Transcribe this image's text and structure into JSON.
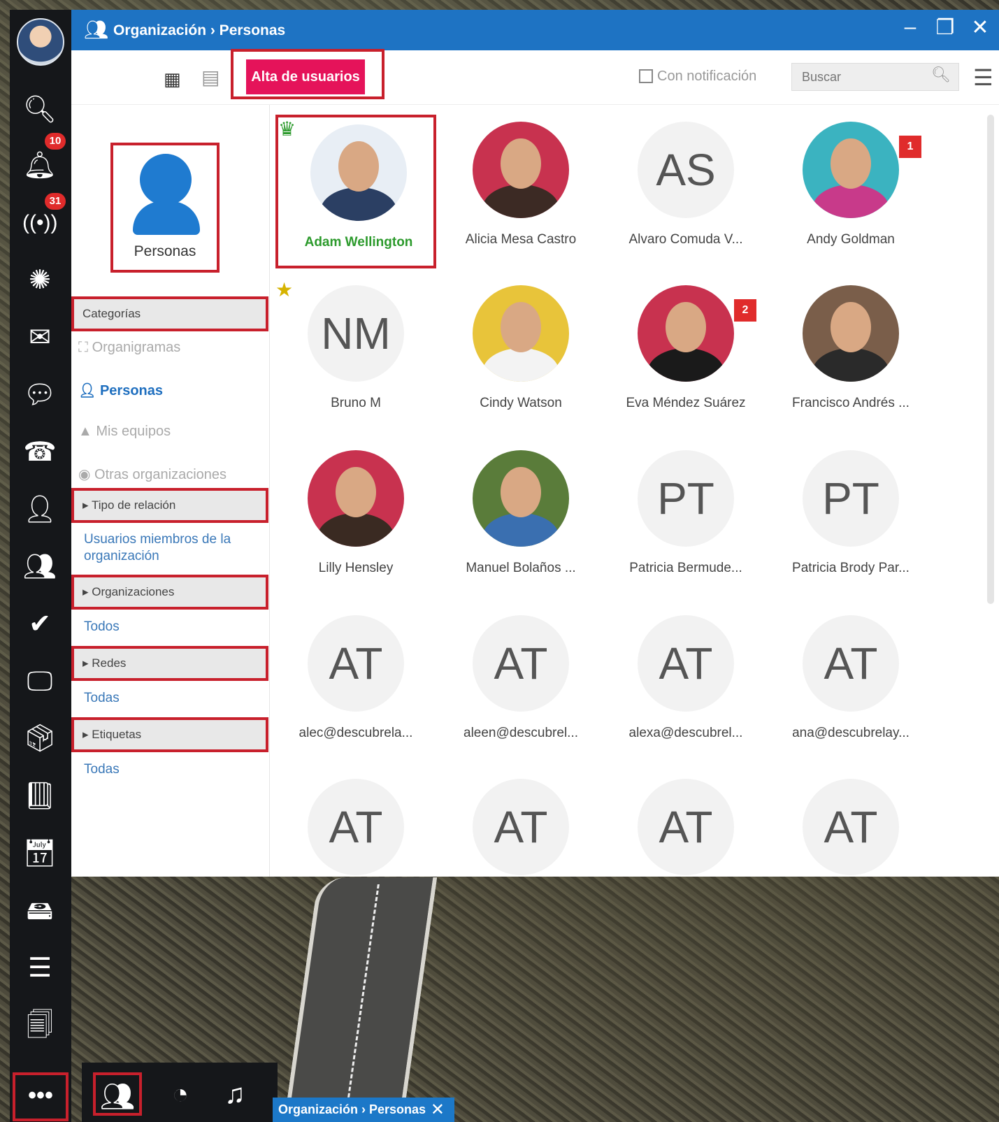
{
  "window": {
    "title": "Organización › Personas",
    "minimize": "–",
    "maximize": "❐",
    "close": "✕"
  },
  "toolbar": {
    "alta_label": "Alta de usuarios",
    "uncategorized_label": "Con notificación",
    "search_placeholder": "Buscar",
    "view_grid_icon": "grid-icon",
    "view_table_icon": "table-icon"
  },
  "sidebar": {
    "personas_label": "Personas",
    "categories_header": "Categorías",
    "items": [
      {
        "label": "Organigramas",
        "icon": "org-chart-icon"
      },
      {
        "label": "Personas",
        "icon": "person-icon"
      },
      {
        "label": "Mis equipos",
        "icon": "team-icon"
      },
      {
        "label": "Otras organizaciones",
        "icon": "globe-icon"
      }
    ],
    "relation_header": "Tipo de relación",
    "relation_value": "Usuarios miembros de la organización",
    "orgs_header": "Organizaciones",
    "orgs_value": "Todos",
    "networks_header": "Redes",
    "networks_value": "Todas",
    "tags_header": "Etiquetas",
    "tags_value": "Todas"
  },
  "people": [
    {
      "name": "Adam Wellington",
      "kind": "photo",
      "bg": "#e8eef5",
      "body": "#2b3f63",
      "crown": true,
      "highlight": true,
      "name_color": "#2c9a2c"
    },
    {
      "name": "Alicia Mesa Castro",
      "kind": "photo",
      "bg": "#c8324f",
      "body": "#3c2a24"
    },
    {
      "name": "Alvaro Comuda V...",
      "kind": "initials",
      "initials": "AS"
    },
    {
      "name": "Andy Goldman",
      "kind": "photo",
      "bg": "#3bb3c0",
      "body": "#c83a8a",
      "badge": "1"
    },
    {
      "name": "Bruno M",
      "kind": "initials",
      "initials": "NM",
      "star": true
    },
    {
      "name": "Cindy Watson",
      "kind": "photo",
      "bg": "#e8c43a",
      "body": "#f3f3f3"
    },
    {
      "name": "Eva Méndez Suárez",
      "kind": "photo",
      "bg": "#c8324f",
      "body": "#1a1a1a",
      "badge": "2"
    },
    {
      "name": "Francisco Andrés ...",
      "kind": "photo",
      "bg": "#7a5e4a",
      "body": "#2a2a2a"
    },
    {
      "name": "Lilly Hensley",
      "kind": "photo",
      "bg": "#c8324f",
      "body": "#3a2a22"
    },
    {
      "name": "Manuel Bolaños ...",
      "kind": "photo",
      "bg": "#5a7c3a",
      "body": "#3a6fb0"
    },
    {
      "name": "Patricia Bermude...",
      "kind": "initials",
      "initials": "PT"
    },
    {
      "name": "Patricia Brody Par...",
      "kind": "initials",
      "initials": "PT"
    },
    {
      "name": "alec@descubrela...",
      "kind": "initials",
      "initials": "AT"
    },
    {
      "name": "aleen@descubrel...",
      "kind": "initials",
      "initials": "AT"
    },
    {
      "name": "alexa@descubrel...",
      "kind": "initials",
      "initials": "AT"
    },
    {
      "name": "ana@descubrelay...",
      "kind": "initials",
      "initials": "AT"
    },
    {
      "name": "",
      "kind": "initials",
      "initials": "AT"
    },
    {
      "name": "",
      "kind": "initials",
      "initials": "AT"
    },
    {
      "name": "",
      "kind": "initials",
      "initials": "AT"
    },
    {
      "name": "",
      "kind": "initials",
      "initials": "AT"
    }
  ],
  "taskbar": {
    "notifications_badge": "10",
    "broadcast_badge": "31",
    "more_label": "•••"
  },
  "tray": {
    "tab_label": "Organización › Personas",
    "tab_close": "✕"
  }
}
